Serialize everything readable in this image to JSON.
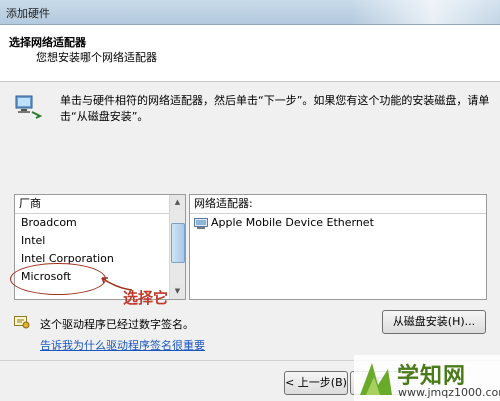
{
  "window": {
    "title": "添加硬件"
  },
  "header": {
    "title": "选择网络适配器",
    "subtitle": "您想安装哪个网络适配器"
  },
  "instruction": "单击与硬件相符的网络适配器，然后单击“下一步”。如果您有这个功能的安装磁盘，请单击“从磁盘安装”。",
  "manufacturers": {
    "header": "厂商",
    "items": [
      {
        "label": "Broadcom"
      },
      {
        "label": "Intel"
      },
      {
        "label": "Intel Corporation"
      },
      {
        "label": "Microsoft"
      }
    ]
  },
  "adapters": {
    "header": "网络适配器:",
    "items": [
      {
        "label": "Apple Mobile Device Ethernet",
        "icon": "network-adapter-icon"
      }
    ]
  },
  "annotation": {
    "text": "选择它",
    "color": "#c0392b"
  },
  "signature": {
    "text": "这个驱动程序已经过数字签名。",
    "link": "告诉我为什么驱动程序签名很重要"
  },
  "buttons": {
    "have_disk": "从磁盘安装(H)...",
    "back": "< 上一步(B)",
    "next": "下"
  },
  "watermark": {
    "text": "学知网",
    "url": "www.jmqz1000.com"
  }
}
